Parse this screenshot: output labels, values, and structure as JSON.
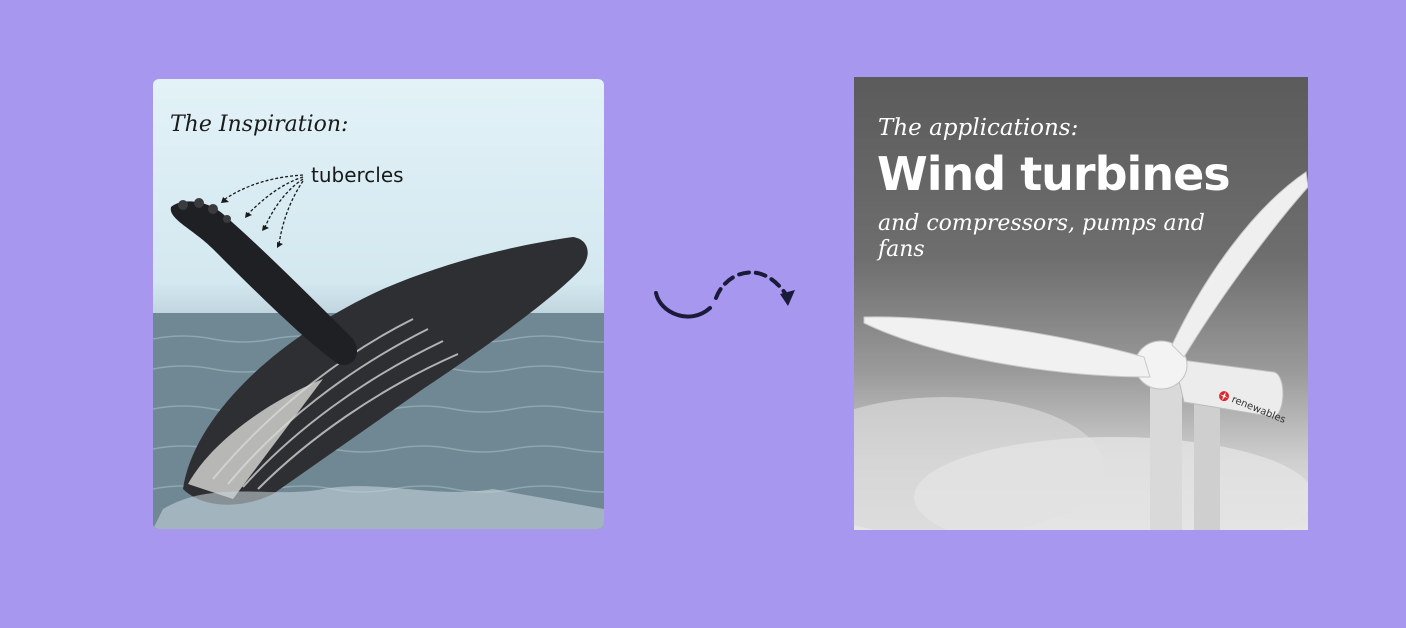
{
  "left_card": {
    "heading": "The Inspiration:",
    "annotation": "tubercles"
  },
  "right_card": {
    "kicker": "The applications:",
    "title": "Wind turbines",
    "subtitle": "and compressors, pumps and fans",
    "brand": "renewables"
  },
  "colors": {
    "background": "#a797ee",
    "arrow": "#1a1a3a",
    "brand_red": "#d9282f"
  },
  "icons": {
    "connector": "dashed-curved-arrow-icon",
    "brand_logo": "renewables-logo-icon"
  }
}
